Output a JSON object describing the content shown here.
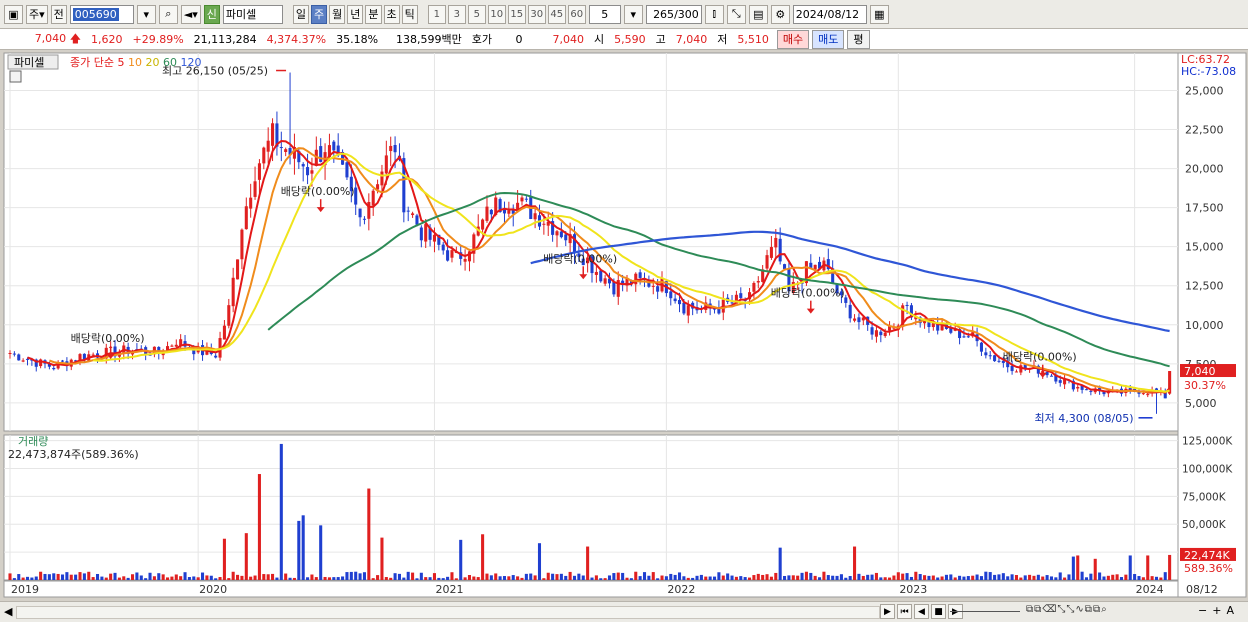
{
  "toolbar": {
    "period_label": "주",
    "prev_label": "전",
    "stock_code": "005690",
    "stock_name": "파미셀",
    "credit_badge": "신",
    "timeframes": [
      "일",
      "주",
      "월",
      "년",
      "분",
      "초",
      "틱"
    ],
    "active_timeframe": "주",
    "tick_steps": [
      "1",
      "3",
      "5",
      "10",
      "15",
      "30",
      "45",
      "60"
    ],
    "interval_value": "5",
    "count": "265",
    "count_max": "/300",
    "date": "2024/08/12"
  },
  "quote": {
    "price": "7,040",
    "change": "1,620",
    "change_pct": "+29.89%",
    "volume": "21,113,284",
    "volume_pct": "4,374.37%",
    "turnover": "35.18%",
    "amount": "138,599백만",
    "hoga_label": "호가",
    "hoga_value": "0",
    "hoga_price": "7,040",
    "open_label": "시",
    "open": "5,590",
    "high_label": "고",
    "high": "7,040",
    "low_label": "저",
    "low": "5,510",
    "buy_label": "매수",
    "sell_label": "매도",
    "avg_label": "평"
  },
  "colors": {
    "up": "#e02020",
    "down": "#1f3fd0",
    "ma5": "#e31818",
    "ma10": "#f08c1c",
    "ma20": "#f0e41c",
    "ma60": "#2e8b57",
    "ma120": "#2f56d6"
  },
  "chart_data": {
    "type": "candlestick",
    "stock_name": "파미셀",
    "legend": {
      "prefix": "종가 단순",
      "periods": [
        "5",
        "10",
        "20",
        "60",
        "120"
      ]
    },
    "max_note": "최고 26,150 (05/25)",
    "min_note": "최저 4,300 (08/05)",
    "lc_label": "LC:63.72",
    "hc_label": "HC:-73.08",
    "price_tag": "7,040",
    "price_tag_pct": "30.37%",
    "price_axis": {
      "range": [
        3200,
        27400
      ],
      "ticks": [
        5000,
        7500,
        10000,
        12500,
        15000,
        17500,
        20000,
        22500,
        25000
      ],
      "tick_labels": [
        "5,000",
        "7,500",
        "10,000",
        "12,500",
        "15,000",
        "17,500",
        "20,000",
        "22,500",
        "25,000"
      ]
    },
    "x_labels": [
      "2019",
      "2020",
      "2021",
      "2022",
      "2023",
      "2024",
      "08/12"
    ],
    "x_label_weeks": [
      0,
      43,
      97,
      150,
      203,
      257,
      265
    ],
    "dividend_label": "배당락(0.00%)",
    "dividend_weeks": [
      23,
      71,
      131,
      183,
      236
    ],
    "dividend_label_values": [
      8900,
      18300,
      14000,
      11800,
      7700
    ],
    "price_anchors": [
      [
        0,
        8200
      ],
      [
        6,
        7600
      ],
      [
        10,
        7300
      ],
      [
        16,
        8000
      ],
      [
        22,
        8200
      ],
      [
        28,
        8400
      ],
      [
        34,
        8200
      ],
      [
        38,
        9000
      ],
      [
        43,
        8300
      ],
      [
        47,
        8100
      ],
      [
        50,
        11000
      ],
      [
        53,
        16500
      ],
      [
        56,
        20000
      ],
      [
        60,
        22000
      ],
      [
        64,
        21000
      ],
      [
        68,
        20000
      ],
      [
        72,
        21500
      ],
      [
        76,
        19500
      ],
      [
        80,
        16800
      ],
      [
        84,
        19500
      ],
      [
        88,
        21500
      ],
      [
        90,
        18000
      ],
      [
        94,
        16000
      ],
      [
        98,
        15000
      ],
      [
        102,
        14200
      ],
      [
        106,
        15500
      ],
      [
        110,
        17500
      ],
      [
        114,
        18000
      ],
      [
        118,
        17500
      ],
      [
        122,
        16800
      ],
      [
        126,
        16000
      ],
      [
        130,
        14800
      ],
      [
        134,
        13500
      ],
      [
        138,
        12500
      ],
      [
        142,
        12800
      ],
      [
        146,
        12700
      ],
      [
        150,
        12500
      ],
      [
        154,
        11200
      ],
      [
        158,
        11000
      ],
      [
        162,
        11100
      ],
      [
        166,
        11500
      ],
      [
        169,
        11600
      ],
      [
        173,
        14200
      ],
      [
        175,
        15000
      ],
      [
        178,
        12000
      ],
      [
        182,
        13500
      ],
      [
        186,
        13800
      ],
      [
        190,
        11500
      ],
      [
        194,
        10200
      ],
      [
        198,
        9500
      ],
      [
        202,
        10000
      ],
      [
        205,
        11200
      ],
      [
        208,
        10400
      ],
      [
        212,
        9800
      ],
      [
        216,
        9500
      ],
      [
        220,
        9200
      ],
      [
        224,
        8000
      ],
      [
        228,
        7400
      ],
      [
        232,
        7200
      ],
      [
        236,
        7100
      ],
      [
        240,
        6500
      ],
      [
        244,
        6000
      ],
      [
        248,
        5800
      ],
      [
        252,
        5600
      ],
      [
        256,
        5700
      ],
      [
        258,
        5800
      ],
      [
        262,
        5700
      ],
      [
        264,
        5400
      ],
      [
        265,
        7040
      ]
    ],
    "max_price": 26150,
    "min_price": 4300,
    "volume": {
      "title": "거래량",
      "current": "22,473,874주(589.36%)",
      "tag": "22,474K",
      "tag_pct": "589.36%",
      "range": [
        0,
        130000
      ],
      "ticks": [
        25000,
        50000,
        75000,
        100000,
        125000
      ],
      "tick_labels": [
        "25,000K",
        "50,000K",
        "75,000K",
        "100,000K",
        "125,000K"
      ],
      "spikes": [
        [
          57,
          95000
        ],
        [
          62,
          122000
        ],
        [
          54,
          42000
        ],
        [
          49,
          37000
        ],
        [
          66,
          53000
        ],
        [
          67,
          58000
        ],
        [
          71,
          49000
        ],
        [
          82,
          82000
        ],
        [
          85,
          38000
        ],
        [
          103,
          36000
        ],
        [
          108,
          41000
        ],
        [
          121,
          33000
        ],
        [
          132,
          30000
        ],
        [
          176,
          29000
        ],
        [
          193,
          30000
        ],
        [
          243,
          21000
        ],
        [
          244,
          22000
        ],
        [
          248,
          19000
        ],
        [
          256,
          22000
        ],
        [
          260,
          22000
        ],
        [
          265,
          22474
        ]
      ]
    }
  },
  "bottom": {
    "step_icons": [
      "▶",
      "⏮",
      "◀",
      "■",
      "▶"
    ],
    "zoom_icons": [
      "−",
      "+",
      "A"
    ]
  }
}
